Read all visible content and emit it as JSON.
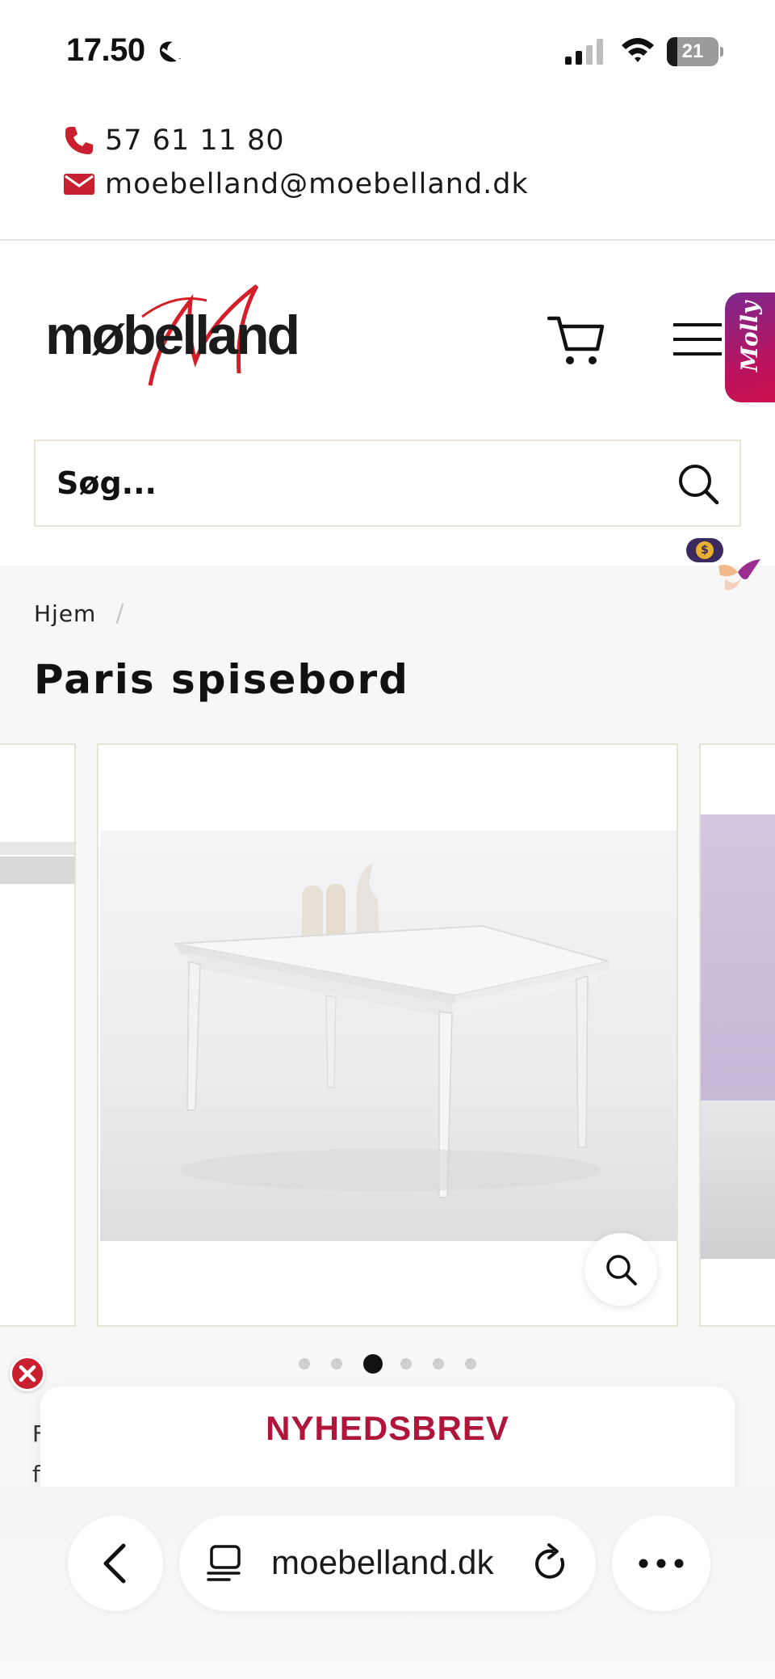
{
  "status_bar": {
    "time": "17.50",
    "battery_level": 21,
    "battery_label": "21",
    "icons": [
      "moon-icon",
      "cellular-signal-icon",
      "wifi-icon",
      "battery-icon"
    ]
  },
  "contact": {
    "phone": "57 61 11 80",
    "email": "moebelland@moebelland.dk",
    "icons": [
      "phone-icon",
      "envelope-icon"
    ],
    "icon_color": "#c8202f"
  },
  "header": {
    "logo_text": "møbelland",
    "logo_accent_color": "#d41f2a",
    "icons": [
      "cart-icon",
      "hamburger-menu-icon"
    ],
    "molly_label": "Molly"
  },
  "search": {
    "placeholder": "Søg..."
  },
  "breadcrumb": {
    "home": "Hjem",
    "separator": "/"
  },
  "product": {
    "title": "Paris spisebord"
  },
  "gallery": {
    "slide_count": 6,
    "active_index": 2
  },
  "newsletter": {
    "title": "NYHEDSBREV",
    "title_color": "#b0163a",
    "partial_line_1": "F",
    "partial_line_2": "f"
  },
  "browser": {
    "url": "moebelland.dk",
    "icons": [
      "back-chevron-icon",
      "tabs-icon",
      "reload-icon",
      "more-icon"
    ]
  }
}
